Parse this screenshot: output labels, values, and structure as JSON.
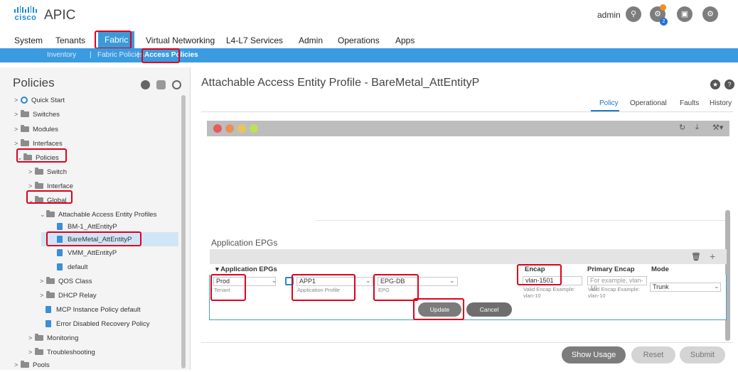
{
  "header": {
    "logo_text": "cisco",
    "app_title": "APIC",
    "user": "admin",
    "badge_count": "2"
  },
  "main_nav": [
    "System",
    "Tenants",
    "Fabric",
    "Virtual Networking",
    "L4-L7 Services",
    "Admin",
    "Operations",
    "Apps"
  ],
  "sub_nav": [
    "Inventory",
    "Fabric Policies",
    "Access Policies"
  ],
  "sub_nav_separator": "|",
  "left_panel": {
    "title": "Policies",
    "tree": [
      {
        "label": "Quick Start"
      },
      {
        "label": "Switches"
      },
      {
        "label": "Modules"
      },
      {
        "label": "Interfaces"
      },
      {
        "label": "Policies"
      },
      {
        "label": "Switch"
      },
      {
        "label": "Interface"
      },
      {
        "label": "Global"
      },
      {
        "label": "Attachable Access Entity Profiles"
      },
      {
        "label": "BM-1_AttEntityP"
      },
      {
        "label": "BareMetal_AttEntityP"
      },
      {
        "label": "VMM_AttEntityP"
      },
      {
        "label": "default"
      },
      {
        "label": "QOS Class"
      },
      {
        "label": "DHCP Relay"
      },
      {
        "label": "MCP Instance Policy default"
      },
      {
        "label": "Error Disabled Recovery Policy"
      },
      {
        "label": "Monitoring"
      },
      {
        "label": "Troubleshooting"
      },
      {
        "label": "Pools"
      }
    ]
  },
  "main": {
    "title": "Attachable Access Entity Profile - BareMetal_AttEntityP",
    "tabs": [
      "Policy",
      "Operational",
      "Faults",
      "History"
    ],
    "section_title": "Application EPGs",
    "columns": {
      "group": "Application EPGs",
      "encap": "Encap",
      "primary_encap": "Primary Encap",
      "mode": "Mode"
    },
    "row": {
      "tenant_value": "Prod",
      "tenant_label": "Tenant",
      "app_profile_value": "APP1",
      "app_profile_label": "Application Profile",
      "epg_value": "EPG-DB",
      "epg_label": "EPG",
      "encap_value": "vlan-1501",
      "encap_hint": "Valid Encap Example: vlan-10",
      "primary_encap_placeholder": "For example, vlan-10",
      "primary_encap_hint": "Valid Encap Example: vlan-10",
      "mode_value": "Trunk"
    },
    "update_label": "Update",
    "cancel_label": "Cancel",
    "show_usage_label": "Show Usage",
    "reset_label": "Reset",
    "submit_label": "Submit"
  },
  "icons": {
    "search": "search-icon",
    "alerts": "alerts-icon",
    "feedback": "feedback-icon",
    "settings": "gear-icon"
  },
  "colors": {
    "accent": "#3b9be0",
    "active_tab": "#3a9ad9",
    "highlight": "#e0001b"
  }
}
